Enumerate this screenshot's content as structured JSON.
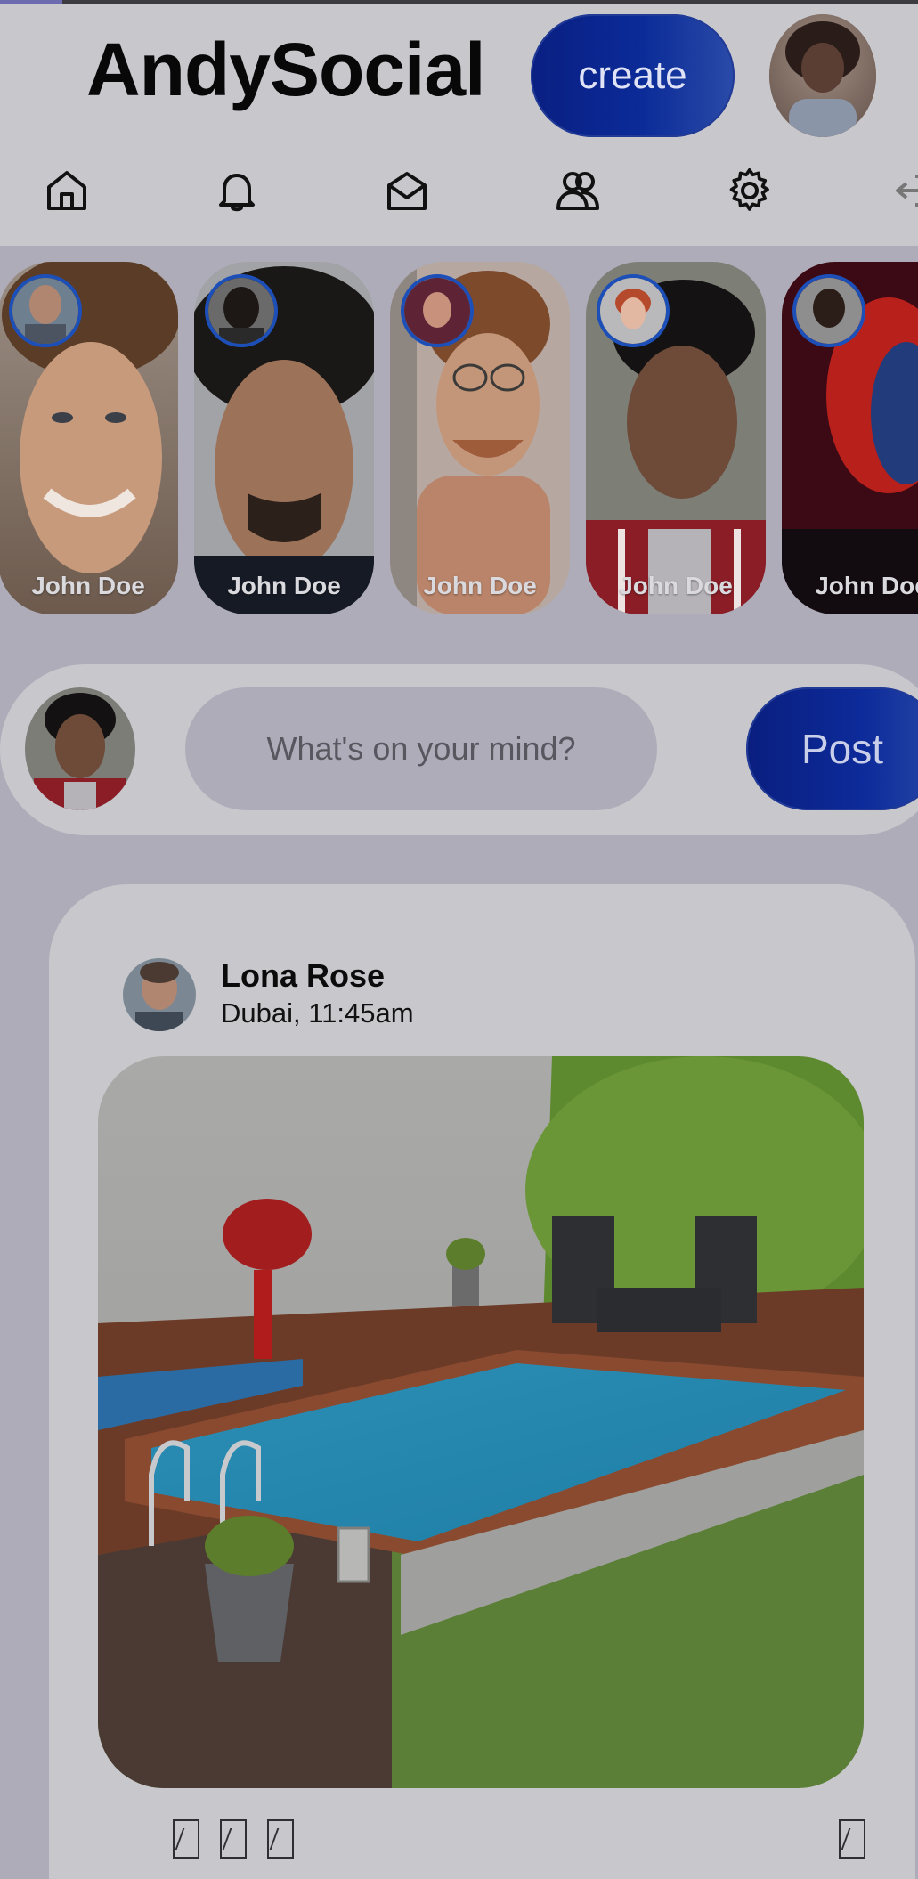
{
  "app": {
    "title": "AndySocial"
  },
  "header": {
    "create_label": "create",
    "profile_icon": "user-avatar"
  },
  "nav": {
    "items": [
      {
        "name": "home",
        "icon": "home-icon"
      },
      {
        "name": "notifications",
        "icon": "bell-icon"
      },
      {
        "name": "messages",
        "icon": "mail-open-icon"
      },
      {
        "name": "friends",
        "icon": "users-icon"
      },
      {
        "name": "settings",
        "icon": "gear-icon"
      },
      {
        "name": "logout",
        "icon": "logout-icon"
      }
    ]
  },
  "stories": [
    {
      "name": "John Doe"
    },
    {
      "name": "John Doe"
    },
    {
      "name": "John Doe"
    },
    {
      "name": "John Doe"
    },
    {
      "name": "John Doe"
    }
  ],
  "composer": {
    "placeholder": "What's on your mind?",
    "post_label": "Post"
  },
  "post": {
    "author": "Lona Rose",
    "meta": "Dubai, 11:45am",
    "actions": [
      "like-icon",
      "comment-icon",
      "share-icon",
      "bookmark-icon"
    ]
  },
  "colors": {
    "accent": "#0b2b98",
    "page_bg": "#aeacb8",
    "card_bg": "#c8c7cc",
    "story_ring": "#1d4fb8"
  }
}
